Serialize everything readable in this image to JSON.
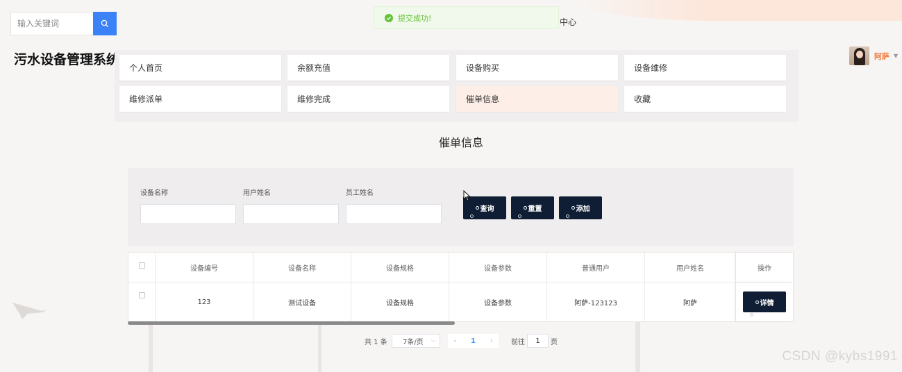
{
  "search": {
    "placeholder": "输入关键词"
  },
  "toast": {
    "message": "提交成功!"
  },
  "header": {
    "center_link": "中心"
  },
  "site_title": "污水设备管理系统",
  "user": {
    "name": "阿萨"
  },
  "nav": {
    "items": [
      {
        "label": "个人首页"
      },
      {
        "label": "余额充值"
      },
      {
        "label": "设备购买"
      },
      {
        "label": "设备维修"
      },
      {
        "label": "维修派单"
      },
      {
        "label": "维修完成"
      },
      {
        "label": "催单信息",
        "active": true
      },
      {
        "label": "收藏"
      }
    ]
  },
  "section_title": "催单信息",
  "filters": {
    "device_name_label": "设备名称",
    "user_name_label": "用户姓名",
    "staff_name_label": "员工姓名",
    "query_label": "查询",
    "reset_label": "重置",
    "add_label": "添加"
  },
  "table": {
    "columns": [
      "设备编号",
      "设备名称",
      "设备规格",
      "设备参数",
      "普通用户",
      "用户姓名",
      "操作"
    ],
    "rows": [
      {
        "cells": [
          "123",
          "测试设备",
          "设备规格",
          "设备参数",
          "阿萨-123123",
          "阿萨"
        ],
        "action": "详情"
      }
    ]
  },
  "pagination": {
    "total": "共 1 条",
    "page_size": "7条/页",
    "current_page": "1",
    "goto_label": "前往",
    "goto_value": "1",
    "page_suffix": "页"
  },
  "watermark": "CSDN @kybs1991",
  "colors": {
    "accent": "#3b82f6",
    "dark_button": "#0f1e35",
    "active_nav": "#fdeee7",
    "user_name": "#f27a3a",
    "toast_green": "#67c23a"
  }
}
